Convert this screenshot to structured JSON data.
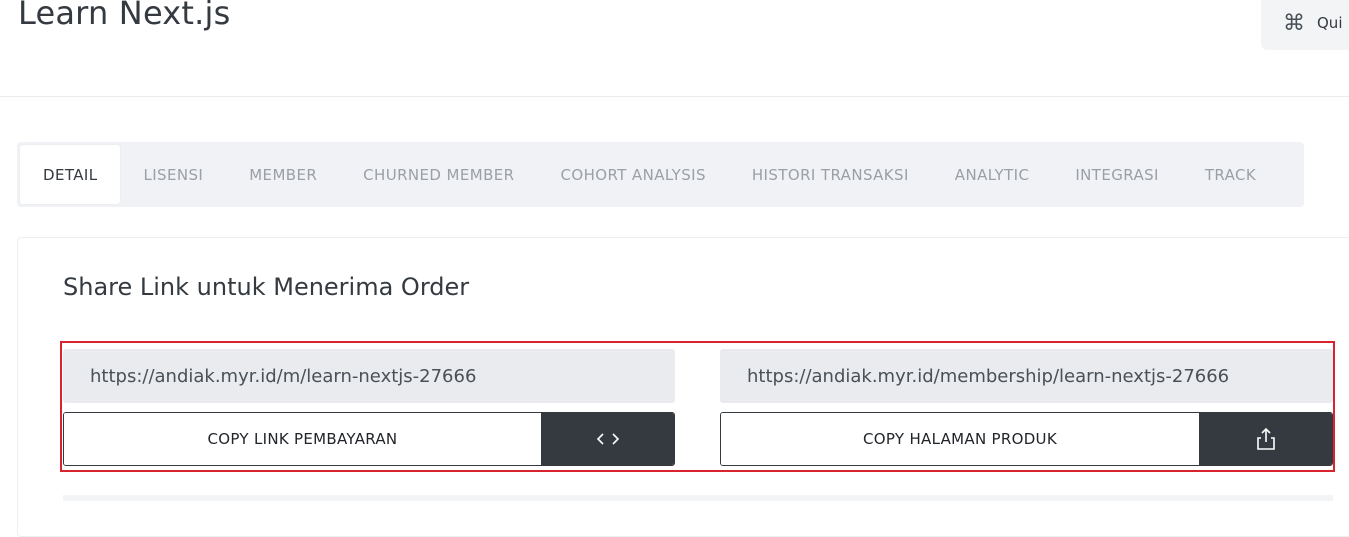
{
  "header": {
    "title": "Learn Next.js",
    "quick_button": {
      "icon": "command-icon",
      "label": "Qui"
    }
  },
  "tabs": [
    {
      "label": "DETAIL",
      "active": true
    },
    {
      "label": "LISENSI",
      "active": false
    },
    {
      "label": "MEMBER",
      "active": false
    },
    {
      "label": "CHURNED MEMBER",
      "active": false
    },
    {
      "label": "COHORT ANALYSIS",
      "active": false
    },
    {
      "label": "HISTORI TRANSAKSI",
      "active": false
    },
    {
      "label": "ANALYTIC",
      "active": false
    },
    {
      "label": "INTEGRASI",
      "active": false
    },
    {
      "label": "TRACK",
      "active": false
    }
  ],
  "share": {
    "title": "Share Link untuk Menerima Order",
    "payment": {
      "url": "https://andiak.myr.id/m/learn-nextjs-27666",
      "copy_label": "COPY LINK PEMBAYARAN",
      "icon": "code-icon"
    },
    "product": {
      "url": "https://andiak.myr.id/membership/learn-nextjs-27666",
      "copy_label": "COPY HALAMAN PRODUK",
      "icon": "share-icon"
    },
    "highlight_color": "#d9232e"
  },
  "colors": {
    "dark_button": "#343a40",
    "field_bg": "#e9ebee",
    "tabs_bg": "#f1f2f6"
  }
}
